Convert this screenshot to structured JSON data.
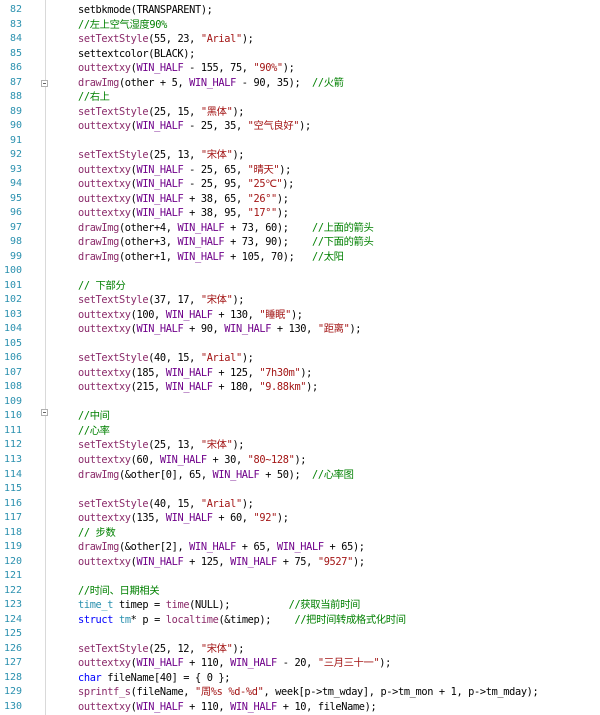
{
  "editor": {
    "lines": [
      {
        "n": "82",
        "tokens": [
          [
            "plain",
            "setbkmode(TRANSPARENT);"
          ]
        ]
      },
      {
        "n": "83",
        "tokens": [
          [
            "comment",
            "//左上空气湿度90%"
          ]
        ]
      },
      {
        "n": "84",
        "tokens": [
          [
            "func",
            "setTextStyle"
          ],
          [
            "plain",
            "(55, 23, "
          ],
          [
            "string",
            "\"Arial\""
          ],
          [
            "plain",
            ");"
          ]
        ]
      },
      {
        "n": "85",
        "tokens": [
          [
            "plain",
            "settextcolor(BLACK);"
          ]
        ]
      },
      {
        "n": "86",
        "tokens": [
          [
            "func",
            "outtextxy"
          ],
          [
            "plain",
            "("
          ],
          [
            "macro",
            "WIN_HALF"
          ],
          [
            "plain",
            " - 155, 75, "
          ],
          [
            "string",
            "\"90%\""
          ],
          [
            "plain",
            ");"
          ]
        ]
      },
      {
        "n": "87",
        "tokens": [
          [
            "func",
            "drawImg"
          ],
          [
            "plain",
            "(other + 5, "
          ],
          [
            "macro",
            "WIN_HALF"
          ],
          [
            "plain",
            " - 90, 35);  "
          ],
          [
            "comment",
            "//火箭"
          ]
        ]
      },
      {
        "n": "88",
        "tokens": [
          [
            "comment",
            "//右上"
          ]
        ]
      },
      {
        "n": "89",
        "tokens": [
          [
            "func",
            "setTextStyle"
          ],
          [
            "plain",
            "(25, 15, "
          ],
          [
            "string",
            "\"黑体\""
          ],
          [
            "plain",
            ");"
          ]
        ]
      },
      {
        "n": "90",
        "tokens": [
          [
            "func",
            "outtextxy"
          ],
          [
            "plain",
            "("
          ],
          [
            "macro",
            "WIN_HALF"
          ],
          [
            "plain",
            " - 25, 35, "
          ],
          [
            "string",
            "\"空气良好\""
          ],
          [
            "plain",
            ");"
          ]
        ]
      },
      {
        "n": "91",
        "tokens": []
      },
      {
        "n": "92",
        "tokens": [
          [
            "func",
            "setTextStyle"
          ],
          [
            "plain",
            "(25, 13, "
          ],
          [
            "string",
            "\"宋体\""
          ],
          [
            "plain",
            ");"
          ]
        ]
      },
      {
        "n": "93",
        "tokens": [
          [
            "func",
            "outtextxy"
          ],
          [
            "plain",
            "("
          ],
          [
            "macro",
            "WIN_HALF"
          ],
          [
            "plain",
            " - 25, 65, "
          ],
          [
            "string",
            "\"晴天\""
          ],
          [
            "plain",
            ");"
          ]
        ]
      },
      {
        "n": "94",
        "tokens": [
          [
            "func",
            "outtextxy"
          ],
          [
            "plain",
            "("
          ],
          [
            "macro",
            "WIN_HALF"
          ],
          [
            "plain",
            " - 25, 95, "
          ],
          [
            "string",
            "\"25℃\""
          ],
          [
            "plain",
            ");"
          ]
        ]
      },
      {
        "n": "95",
        "tokens": [
          [
            "func",
            "outtextxy"
          ],
          [
            "plain",
            "("
          ],
          [
            "macro",
            "WIN_HALF"
          ],
          [
            "plain",
            " + 38, 65, "
          ],
          [
            "string",
            "\"26°\""
          ],
          [
            "plain",
            ");"
          ]
        ]
      },
      {
        "n": "96",
        "tokens": [
          [
            "func",
            "outtextxy"
          ],
          [
            "plain",
            "("
          ],
          [
            "macro",
            "WIN_HALF"
          ],
          [
            "plain",
            " + 38, 95, "
          ],
          [
            "string",
            "\"17°\""
          ],
          [
            "plain",
            ");"
          ]
        ]
      },
      {
        "n": "97",
        "tokens": [
          [
            "func",
            "drawImg"
          ],
          [
            "plain",
            "(other+4, "
          ],
          [
            "macro",
            "WIN_HALF"
          ],
          [
            "plain",
            " + 73, 60);    "
          ],
          [
            "comment",
            "//上面的箭头"
          ]
        ]
      },
      {
        "n": "98",
        "tokens": [
          [
            "func",
            "drawImg"
          ],
          [
            "plain",
            "(other+3, "
          ],
          [
            "macro",
            "WIN_HALF"
          ],
          [
            "plain",
            " + 73, 90);    "
          ],
          [
            "comment",
            "//下面的箭头"
          ]
        ]
      },
      {
        "n": "99",
        "tokens": [
          [
            "func",
            "drawImg"
          ],
          [
            "plain",
            "(other+1, "
          ],
          [
            "macro",
            "WIN_HALF"
          ],
          [
            "plain",
            " + 105, 70);   "
          ],
          [
            "comment",
            "//太阳"
          ]
        ]
      },
      {
        "n": "100",
        "tokens": []
      },
      {
        "n": "101",
        "tokens": [
          [
            "comment",
            "// 下部分"
          ]
        ]
      },
      {
        "n": "102",
        "tokens": [
          [
            "func",
            "setTextStyle"
          ],
          [
            "plain",
            "(37, 17, "
          ],
          [
            "string",
            "\"宋体\""
          ],
          [
            "plain",
            ");"
          ]
        ]
      },
      {
        "n": "103",
        "tokens": [
          [
            "func",
            "outtextxy"
          ],
          [
            "plain",
            "(100, "
          ],
          [
            "macro",
            "WIN_HALF"
          ],
          [
            "plain",
            " + 130, "
          ],
          [
            "string",
            "\"睡眠\""
          ],
          [
            "plain",
            ");"
          ]
        ]
      },
      {
        "n": "104",
        "tokens": [
          [
            "func",
            "outtextxy"
          ],
          [
            "plain",
            "("
          ],
          [
            "macro",
            "WIN_HALF"
          ],
          [
            "plain",
            " + 90, "
          ],
          [
            "macro",
            "WIN_HALF"
          ],
          [
            "plain",
            " + 130, "
          ],
          [
            "string",
            "\"距离\""
          ],
          [
            "plain",
            ");"
          ]
        ]
      },
      {
        "n": "105",
        "tokens": []
      },
      {
        "n": "106",
        "tokens": [
          [
            "func",
            "setTextStyle"
          ],
          [
            "plain",
            "(40, 15, "
          ],
          [
            "string",
            "\"Arial\""
          ],
          [
            "plain",
            ");"
          ]
        ]
      },
      {
        "n": "107",
        "tokens": [
          [
            "func",
            "outtextxy"
          ],
          [
            "plain",
            "(185, "
          ],
          [
            "macro",
            "WIN_HALF"
          ],
          [
            "plain",
            " + 125, "
          ],
          [
            "string",
            "\"7h30m\""
          ],
          [
            "plain",
            ");"
          ]
        ]
      },
      {
        "n": "108",
        "tokens": [
          [
            "func",
            "outtextxy"
          ],
          [
            "plain",
            "(215, "
          ],
          [
            "macro",
            "WIN_HALF"
          ],
          [
            "plain",
            " + 180, "
          ],
          [
            "string",
            "\"9.88km\""
          ],
          [
            "plain",
            ");"
          ]
        ]
      },
      {
        "n": "109",
        "tokens": []
      },
      {
        "n": "110",
        "tokens": [
          [
            "comment",
            "//中间"
          ]
        ]
      },
      {
        "n": "111",
        "tokens": [
          [
            "comment",
            "//心率"
          ]
        ]
      },
      {
        "n": "112",
        "tokens": [
          [
            "func",
            "setTextStyle"
          ],
          [
            "plain",
            "(25, 13, "
          ],
          [
            "string",
            "\"宋体\""
          ],
          [
            "plain",
            ");"
          ]
        ]
      },
      {
        "n": "113",
        "tokens": [
          [
            "func",
            "outtextxy"
          ],
          [
            "plain",
            "(60, "
          ],
          [
            "macro",
            "WIN_HALF"
          ],
          [
            "plain",
            " + 30, "
          ],
          [
            "string",
            "\"80~128\""
          ],
          [
            "plain",
            ");"
          ]
        ]
      },
      {
        "n": "114",
        "tokens": [
          [
            "func",
            "drawImg"
          ],
          [
            "plain",
            "(&other[0], 65, "
          ],
          [
            "macro",
            "WIN_HALF"
          ],
          [
            "plain",
            " + 50);  "
          ],
          [
            "comment",
            "//心率图"
          ]
        ]
      },
      {
        "n": "115",
        "tokens": []
      },
      {
        "n": "116",
        "tokens": [
          [
            "func",
            "setTextStyle"
          ],
          [
            "plain",
            "(40, 15, "
          ],
          [
            "string",
            "\"Arial\""
          ],
          [
            "plain",
            ");"
          ]
        ]
      },
      {
        "n": "117",
        "tokens": [
          [
            "func",
            "outtextxy"
          ],
          [
            "plain",
            "(135, "
          ],
          [
            "macro",
            "WIN_HALF"
          ],
          [
            "plain",
            " + 60, "
          ],
          [
            "string",
            "\"92\""
          ],
          [
            "plain",
            ");"
          ]
        ]
      },
      {
        "n": "118",
        "tokens": [
          [
            "comment",
            "// 步数"
          ]
        ]
      },
      {
        "n": "119",
        "tokens": [
          [
            "func",
            "drawImg"
          ],
          [
            "plain",
            "(&other[2], "
          ],
          [
            "macro",
            "WIN_HALF"
          ],
          [
            "plain",
            " + 65, "
          ],
          [
            "macro",
            "WIN_HALF"
          ],
          [
            "plain",
            " + 65);"
          ]
        ]
      },
      {
        "n": "120",
        "tokens": [
          [
            "func",
            "outtextxy"
          ],
          [
            "plain",
            "("
          ],
          [
            "macro",
            "WIN_HALF"
          ],
          [
            "plain",
            " + 125, "
          ],
          [
            "macro",
            "WIN_HALF"
          ],
          [
            "plain",
            " + 75, "
          ],
          [
            "string",
            "\"9527\""
          ],
          [
            "plain",
            ");"
          ]
        ]
      },
      {
        "n": "121",
        "tokens": []
      },
      {
        "n": "122",
        "tokens": [
          [
            "comment",
            "//时间、日期相关"
          ]
        ]
      },
      {
        "n": "123",
        "tokens": [
          [
            "type",
            "time_t"
          ],
          [
            "plain",
            " timep = "
          ],
          [
            "func",
            "time"
          ],
          [
            "plain",
            "(NULL);          "
          ],
          [
            "comment",
            "//获取当前时间"
          ]
        ]
      },
      {
        "n": "124",
        "tokens": [
          [
            "keyword",
            "struct"
          ],
          [
            "plain",
            " "
          ],
          [
            "type",
            "tm"
          ],
          [
            "plain",
            "* p = "
          ],
          [
            "func",
            "localtime"
          ],
          [
            "plain",
            "(&timep);    "
          ],
          [
            "comment",
            "//把时间转成格式化时间"
          ]
        ]
      },
      {
        "n": "125",
        "tokens": []
      },
      {
        "n": "126",
        "tokens": [
          [
            "func",
            "setTextStyle"
          ],
          [
            "plain",
            "(25, 12, "
          ],
          [
            "string",
            "\"宋体\""
          ],
          [
            "plain",
            ");"
          ]
        ]
      },
      {
        "n": "127",
        "tokens": [
          [
            "func",
            "outtextxy"
          ],
          [
            "plain",
            "("
          ],
          [
            "macro",
            "WIN_HALF"
          ],
          [
            "plain",
            " + 110, "
          ],
          [
            "macro",
            "WIN_HALF"
          ],
          [
            "plain",
            " - 20, "
          ],
          [
            "string",
            "\"三月三十一\""
          ],
          [
            "plain",
            ");"
          ]
        ]
      },
      {
        "n": "128",
        "tokens": [
          [
            "keyword",
            "char"
          ],
          [
            "plain",
            " fileName[40] = { 0 };"
          ]
        ]
      },
      {
        "n": "129",
        "tokens": [
          [
            "func",
            "sprintf_s"
          ],
          [
            "plain",
            "(fileName, "
          ],
          [
            "string",
            "\"周%s %d-%d\""
          ],
          [
            "plain",
            ", week[p->tm_wday], p->tm_mon + 1, p->tm_mday);"
          ]
        ]
      },
      {
        "n": "130",
        "tokens": [
          [
            "func",
            "outtextxy"
          ],
          [
            "plain",
            "("
          ],
          [
            "macro",
            "WIN_HALF"
          ],
          [
            "plain",
            " + 110, "
          ],
          [
            "macro",
            "WIN_HALF"
          ],
          [
            "plain",
            " + 10, fileName);"
          ]
        ]
      }
    ]
  }
}
